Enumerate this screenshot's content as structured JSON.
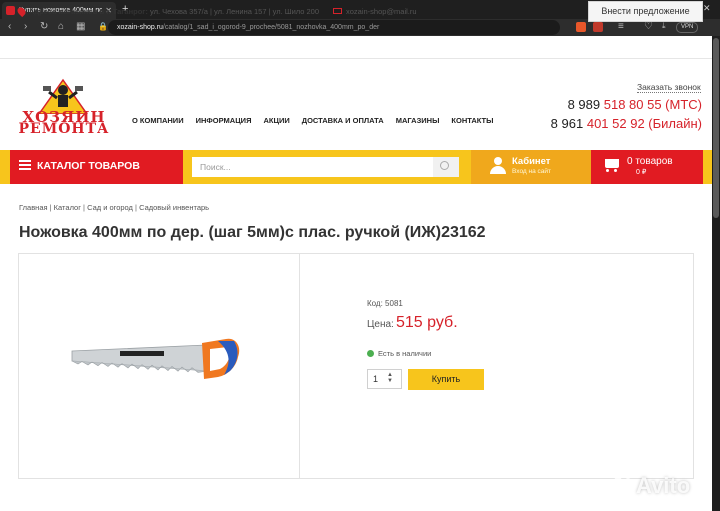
{
  "browser": {
    "tab_title": "Купить ножовка 400мм по дер...",
    "url_host": "xozain-shop.ru",
    "url_path": "/catalog/1_sad_i_ogorod-9_prochee/5081_nozhovka_400mm_po_der",
    "vpn_label": "VPN"
  },
  "topbar": {
    "address_label": "Адреса магазинов в г. Таганрог:",
    "addresses": "ул. Чехова 357/а | ул. Ленина 157 | ул. Шило 200",
    "email": "xozain-shop@mail.ru",
    "suggest_button": "Внести предложение"
  },
  "logo": {
    "line1": "ХОЗЯИН",
    "line2": "РЕМОНТА"
  },
  "nav": [
    "О КОМПАНИИ",
    "ИНФОРМАЦИЯ",
    "АКЦИИ",
    "ДОСТАВКА И ОПЛАТА",
    "МАГАЗИНЫ",
    "КОНТАКТЫ"
  ],
  "contacts": {
    "callback": "Заказать звонок",
    "phone1_prefix": "8 989",
    "phone1_number": "518 80 55 (МТС)",
    "phone2_prefix": "8 961",
    "phone2_number": "401 52 92 (Билайн)"
  },
  "toolbar": {
    "catalog": "КАТАЛОГ ТОВАРОВ",
    "search_placeholder": "Поиск...",
    "cabinet_title": "Кабинет",
    "cabinet_sub": "Вход на сайт",
    "cart_count": "0 товаров",
    "cart_sum": "0 ₽"
  },
  "breadcrumbs": [
    "Главная",
    "Каталог",
    "Сад и огород",
    "Садовый инвентарь"
  ],
  "product": {
    "title": "Ножовка 400мм по дер. (шаг 5мм)с плас. ручкой (ИЖ)23162",
    "code": "Код: 5081",
    "price_label": "Цена:",
    "price": "515 руб.",
    "stock": "Есть в наличии",
    "quantity": "1",
    "buy_button": "Купить"
  },
  "watermark": "Avito"
}
